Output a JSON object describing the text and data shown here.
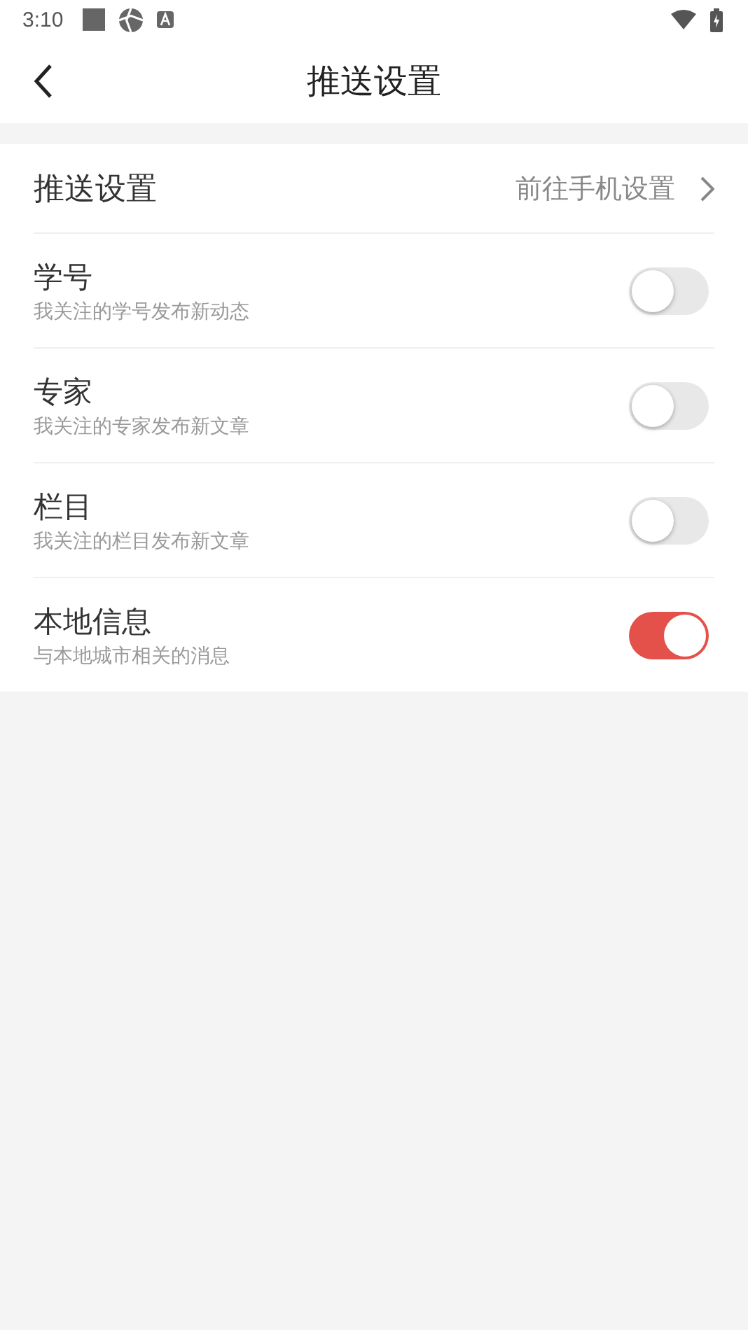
{
  "status_bar": {
    "time": "3:10"
  },
  "header": {
    "title": "推送设置"
  },
  "system_row": {
    "label": "推送设置",
    "value": "前往手机设置"
  },
  "toggles": [
    {
      "title": "学号",
      "subtitle": "我关注的学号发布新动态",
      "on": false
    },
    {
      "title": "专家",
      "subtitle": "我关注的专家发布新文章",
      "on": false
    },
    {
      "title": "栏目",
      "subtitle": "我关注的栏目发布新文章",
      "on": false
    },
    {
      "title": "本地信息",
      "subtitle": "与本地城市相关的消息",
      "on": true
    }
  ]
}
